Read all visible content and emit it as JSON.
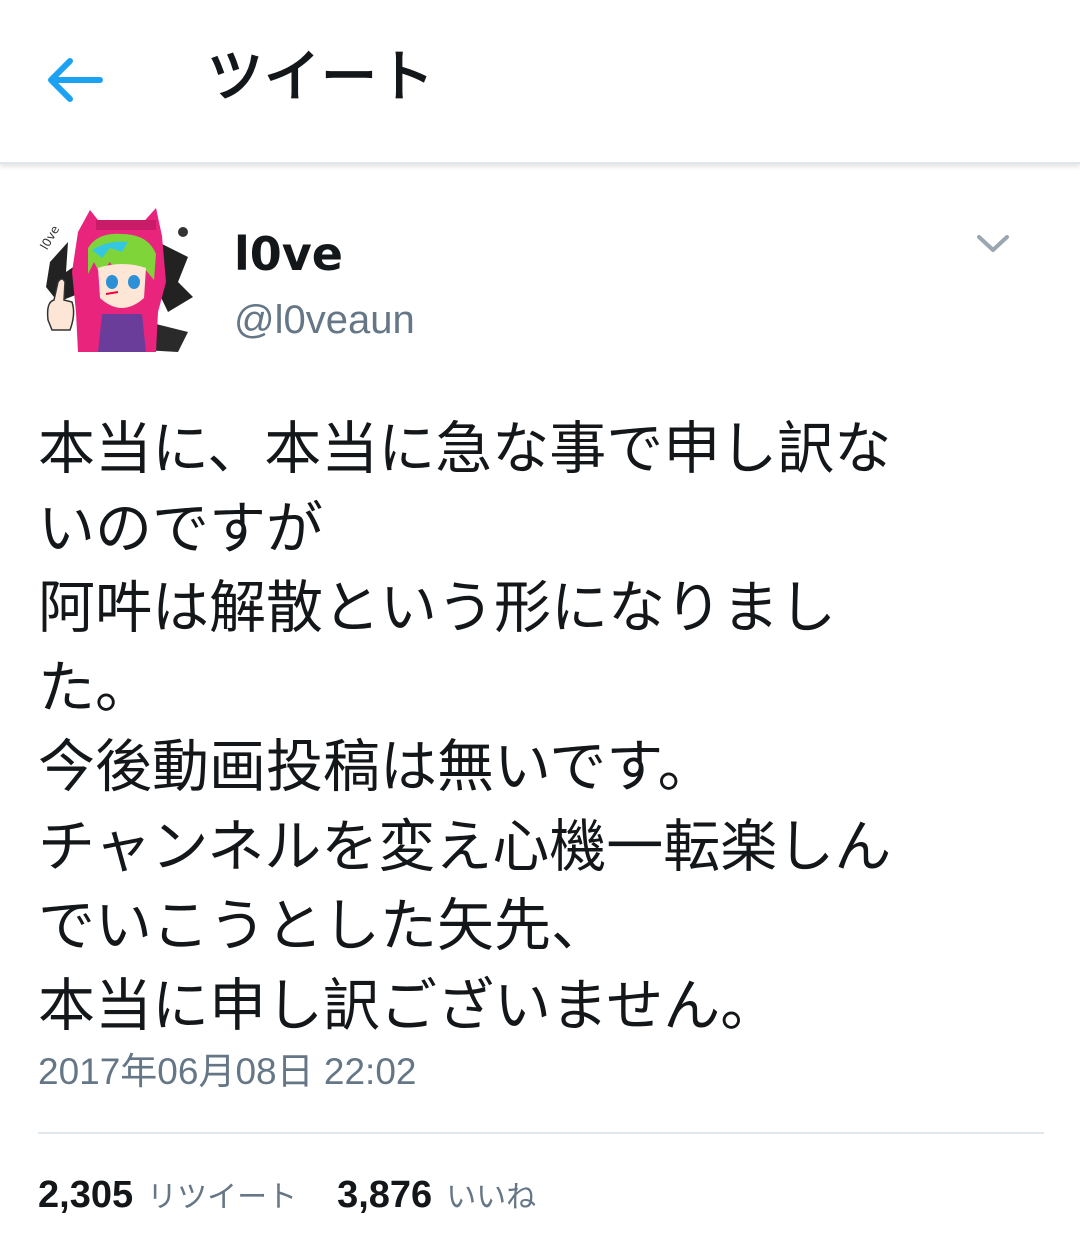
{
  "header": {
    "title": "ツイート",
    "back_icon": "arrow-left-icon"
  },
  "author": {
    "display_name": "l0ve",
    "handle": "@l0veaun",
    "avatar_icon": "avatar-illustration",
    "menu_icon": "chevron-down-icon"
  },
  "tweet": {
    "lines": [
      "本当に、本当に急な事で申し訳な",
      "いのですが",
      "阿吽は解散という形になりまし",
      "た。",
      "今後動画投稿は無いです。",
      "チャンネルを変え心機一転楽しん",
      "でいこうとした矢先、",
      "本当に申し訳ございません。"
    ],
    "timestamp": "2017年06月08日 22:02"
  },
  "stats": {
    "retweets": {
      "count": "2,305",
      "label": "リツイート"
    },
    "likes": {
      "count": "3,876",
      "label": "いいね"
    }
  },
  "colors": {
    "accent": "#1da1f2",
    "text": "#14171a",
    "secondary": "#657786",
    "divider": "#e1e8ed",
    "avatar_hood": "#e8247c"
  }
}
